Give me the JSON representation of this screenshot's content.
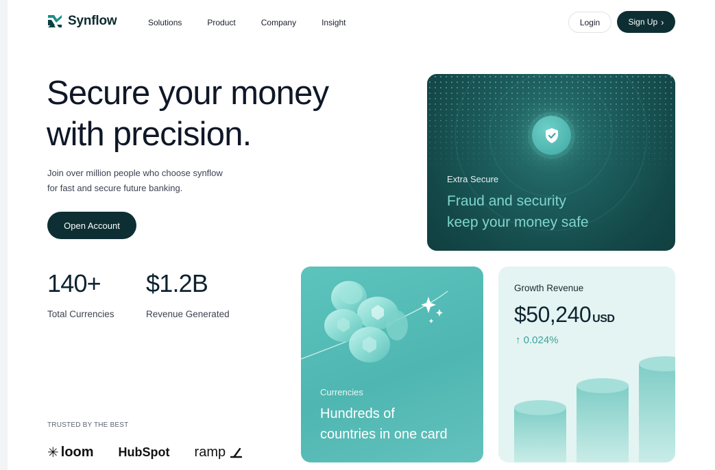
{
  "nav": {
    "brand": "Synflow",
    "links": [
      "Solutions",
      "Product",
      "Company",
      "Insight"
    ],
    "login": "Login",
    "signup": "Sign Up"
  },
  "hero": {
    "title_line1": "Secure your money",
    "title_line2": "with precision.",
    "subtitle_line1": "Join over million people who choose synflow",
    "subtitle_line2": "for fast and secure future banking.",
    "cta": "Open Account"
  },
  "stats": [
    {
      "value": "140+",
      "label": "Total Currencies"
    },
    {
      "value": "$1.2B",
      "label": "Revenue Generated"
    }
  ],
  "trusted": {
    "label": "TRUSTED BY THE BEST",
    "logos": [
      "loom",
      "HubSpot",
      "ramp"
    ]
  },
  "card_secure": {
    "label": "Extra Secure",
    "title_line1": "Fraud and security",
    "title_line2": "keep your money safe",
    "icon": "shield-check-icon"
  },
  "card_currencies": {
    "label": "Currencies",
    "title_line1": "Hundreds of",
    "title_line2": "countries in one card"
  },
  "card_growth": {
    "label": "Growth Revenue",
    "value": "$50,240",
    "unit": "USD",
    "change": "↑ 0.024%"
  },
  "colors": {
    "primary_dark": "#0d2f33",
    "teal": "#4fb6b1",
    "teal_light": "#7fd6cc",
    "mint_bg": "#e4f4f2"
  }
}
